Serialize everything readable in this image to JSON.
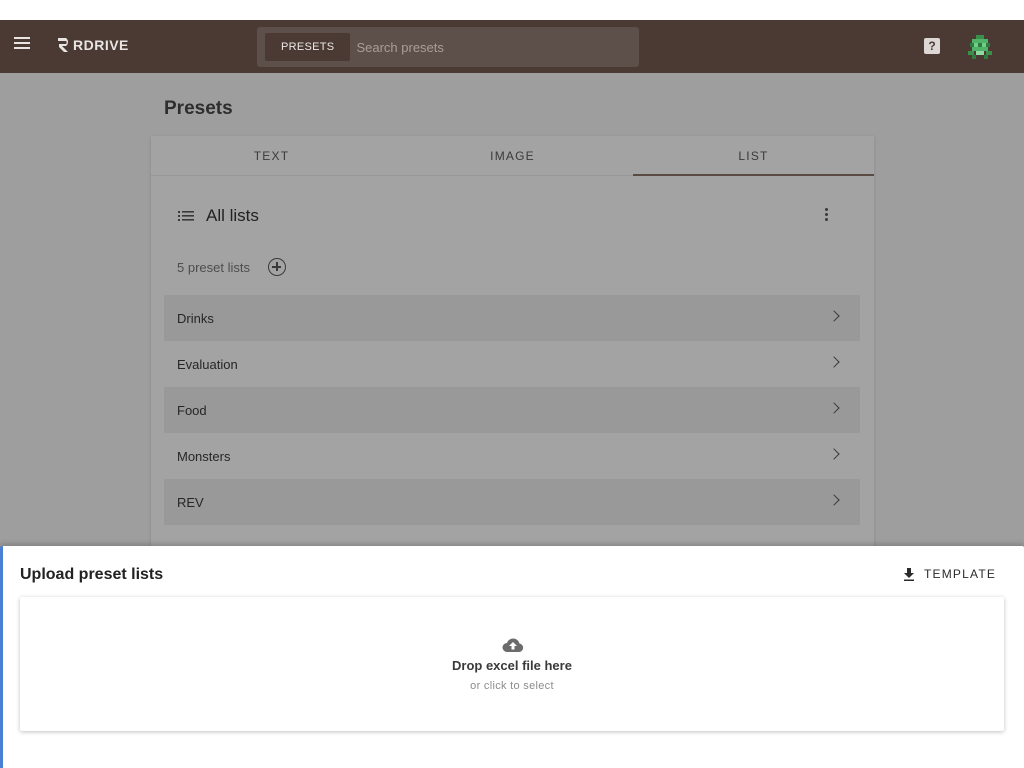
{
  "header": {
    "brand": "RDRIVE",
    "search_chip": "PRESETS",
    "search_placeholder": "Search presets",
    "help_label": "?"
  },
  "page": {
    "title": "Presets"
  },
  "tabs": [
    {
      "label": "TEXT",
      "active": false
    },
    {
      "label": "IMAGE",
      "active": false
    },
    {
      "label": "LIST",
      "active": true
    }
  ],
  "lists": {
    "title": "All lists",
    "count_text": "5 preset lists",
    "items": [
      {
        "label": "Drinks"
      },
      {
        "label": "Evaluation"
      },
      {
        "label": "Food"
      },
      {
        "label": "Monsters"
      },
      {
        "label": "REV"
      }
    ]
  },
  "upload": {
    "title": "Upload preset lists",
    "template_label": "TEMPLATE",
    "drop_main": "Drop excel file here",
    "drop_sub": "or click to select"
  },
  "colors": {
    "appbar": "#4a3a33",
    "accent_border": "#4a7fd6",
    "backdrop": "#9e9e9e"
  },
  "icons": [
    "menu-icon",
    "logo-icon",
    "help-icon",
    "avatar",
    "list-icon",
    "more-vert-icon",
    "add-circle-icon",
    "chevron-right-icon",
    "download-icon",
    "cloud-upload-icon"
  ]
}
